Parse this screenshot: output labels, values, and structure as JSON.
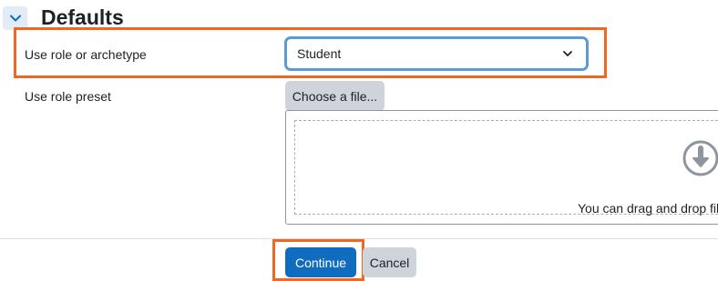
{
  "section": {
    "title": "Defaults",
    "toggle_icon": "chevron-down-icon"
  },
  "fields": {
    "role_label": "Use role or archetype",
    "role_value": "Student",
    "preset_label": "Use role preset",
    "choose_file_label": "Choose a file...",
    "drop_text": "You can drag and drop file"
  },
  "buttons": {
    "continue_label": "Continue",
    "cancel_label": "Cancel"
  },
  "colors": {
    "highlight": "#f26522",
    "primary": "#0f6cbf",
    "focus_border": "#5a9bd5"
  }
}
